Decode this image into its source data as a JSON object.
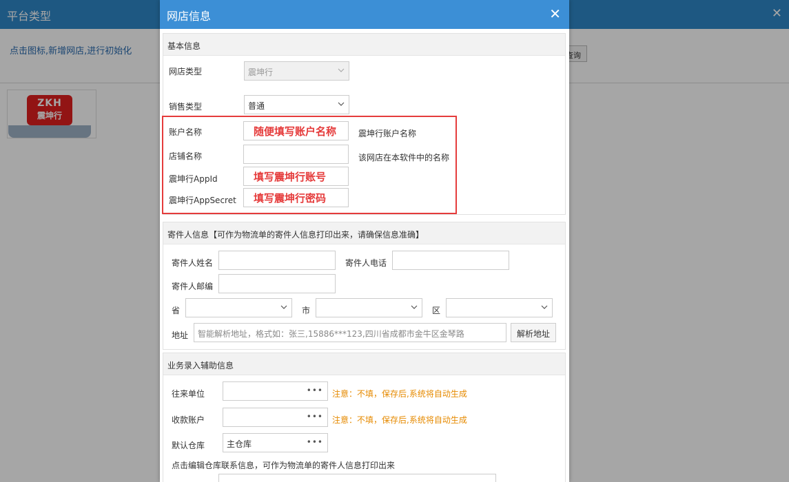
{
  "background": {
    "title": "平台类型",
    "hint": "点击图标,新增网店,进行初始化",
    "query_button": "查询",
    "logo": {
      "line1": "ZKH",
      "line2": "震坤行"
    }
  },
  "dialog": {
    "title": "网店信息",
    "basic": {
      "section_title": "基本信息",
      "shop_type_label": "网店类型",
      "shop_type_value": "震坤行",
      "sales_type_label": "销售类型",
      "sales_type_value": "普通",
      "account_name_label": "账户名称",
      "account_name_value": "随便填写账户名称",
      "account_name_hint": "震坤行账户名称",
      "store_name_label": "店铺名称",
      "store_name_value": "",
      "store_name_hint": "该网店在本软件中的名称",
      "appid_label": "震坤行AppId",
      "appid_value": "填写震坤行账号",
      "appsecret_label": "震坤行AppSecret",
      "appsecret_value": "填写震坤行密码"
    },
    "sender": {
      "section_title": "寄件人信息【可作为物流单的寄件人信息打印出来，请确保信息准确】",
      "name_label": "寄件人姓名",
      "phone_label": "寄件人电话",
      "zip_label": "寄件人邮编",
      "province_label": "省",
      "city_label": "市",
      "district_label": "区",
      "address_label": "地址",
      "address_placeholder": "智能解析地址，格式如：张三,15886***123,四川省成都市金牛区金琴路",
      "parse_button": "解析地址"
    },
    "business": {
      "section_title": "业务录入辅助信息",
      "partner_label": "往来单位",
      "partner_warn": "注意：不填，保存后,系统将自动生成",
      "account_label": "收款账户",
      "account_warn": "注意：不填，保存后,系统将自动生成",
      "warehouse_label": "默认仓库",
      "warehouse_value": "主仓库",
      "warehouse_hint": "点击编辑仓库联系信息，可作为物流单的寄件人信息打印出来"
    }
  },
  "colors": {
    "header": "#3c8fd6",
    "accent_red": "#e53b3b",
    "warn_orange": "#e68a00"
  }
}
